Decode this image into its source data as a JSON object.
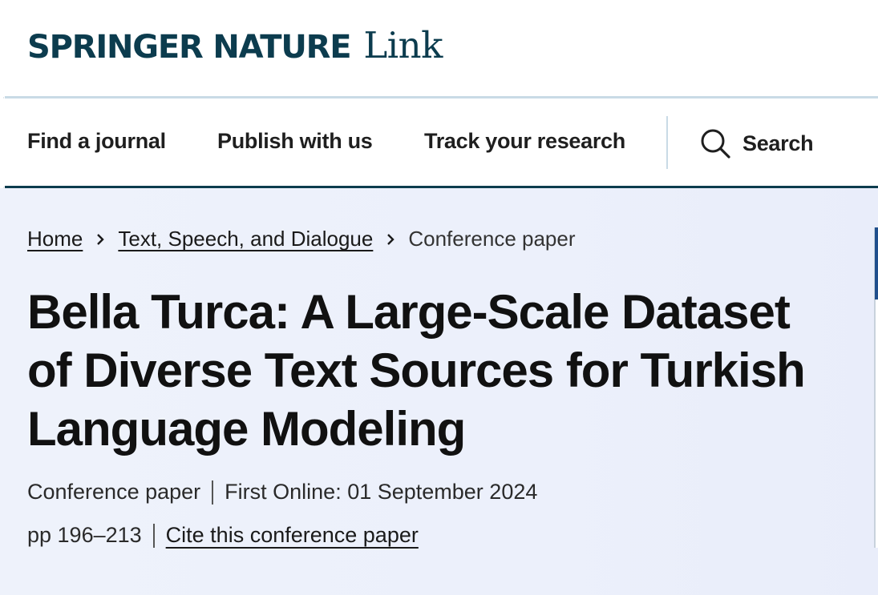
{
  "header": {
    "brand": "SPRINGER NATURE",
    "product": "Link"
  },
  "nav": {
    "items": [
      {
        "label": "Find a journal"
      },
      {
        "label": "Publish with us"
      },
      {
        "label": "Track your research"
      }
    ],
    "search_label": "Search"
  },
  "breadcrumb": {
    "home": "Home",
    "parent": "Text, Speech, and Dialogue",
    "current": "Conference paper"
  },
  "article": {
    "title": "Bella Turca: A Large-Scale Dataset of Diverse Text Sources for Turkish Language Modeling",
    "type": "Conference paper",
    "first_online": "First Online: 01 September 2024",
    "pages": "pp 196–213",
    "cite_label": "Cite this conference paper"
  },
  "colors": {
    "brand": "#0c3c4e",
    "hero_bg": "#eef2fb",
    "rule": "#c9dbe6"
  }
}
